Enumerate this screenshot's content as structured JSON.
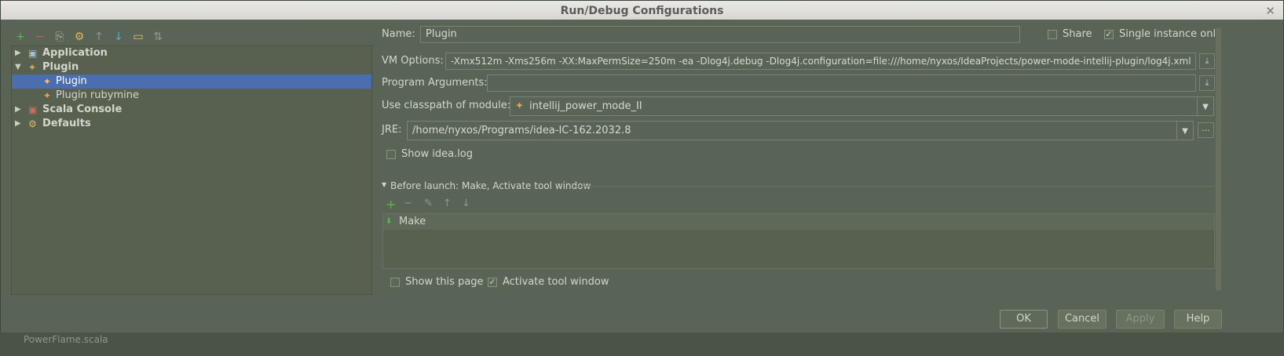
{
  "window": {
    "title": "Run/Debug Configurations",
    "close_glyph": "✕"
  },
  "left_toolbar": [
    {
      "name": "add-icon",
      "glyph": "+",
      "color": "#57b949"
    },
    {
      "name": "remove-icon",
      "glyph": "−",
      "color": "#d2604f"
    },
    {
      "name": "copy-icon",
      "glyph": "⎘",
      "color": "#aab3a6"
    },
    {
      "name": "settings-icon",
      "glyph": "⚙",
      "color": "#e2b45b"
    },
    {
      "name": "move-up-icon",
      "glyph": "↑",
      "color": "#8f988b"
    },
    {
      "name": "move-down-icon",
      "glyph": "↓",
      "color": "#5aa8d8"
    },
    {
      "name": "folder-icon",
      "glyph": "▭",
      "color": "#e2c15b"
    },
    {
      "name": "sort-icon",
      "glyph": "⇅",
      "color": "#8f988b"
    }
  ],
  "tree": {
    "items": [
      {
        "label": "Application",
        "expanded": false,
        "arrow": "▶",
        "icon": "▣"
      },
      {
        "label": "Plugin",
        "expanded": true,
        "arrow": "▼",
        "icon": "🔌"
      },
      {
        "label": "Plugin",
        "selected": true,
        "icon": "🔌"
      },
      {
        "label": "Plugin rubymine",
        "icon": "🔌"
      },
      {
        "label": "Scala Console",
        "expanded": false,
        "arrow": "▶",
        "icon": "▣"
      },
      {
        "label": "Defaults",
        "expanded": false,
        "arrow": "▶",
        "icon": "⚙"
      }
    ]
  },
  "form": {
    "name_label": "Name:",
    "name_value": "Plugin",
    "share_label": "Share",
    "share_checked": false,
    "single_instance_label": "Single instance only",
    "single_instance_checked": true,
    "vm_options_label": "VM Options:",
    "vm_options_value": "-Xmx512m -Xms256m -XX:MaxPermSize=250m -ea  -Dlog4j.debug -Dlog4j.configuration=file:///home/nyxos/IdeaProjects/power-mode-intellij-plugin/log4j.xml",
    "program_args_label": "Program Arguments:",
    "program_args_value": "",
    "classpath_label": "Use classpath of module:",
    "classpath_value": "intellij_power_mode_II",
    "jre_label": "JRE:",
    "jre_value": "/home/nyxos/Programs/idea-IC-162.2032.8",
    "show_idea_log_label": "Show idea.log",
    "show_idea_log_checked": false
  },
  "before_launch": {
    "header": "Before launch: Make, Activate tool window",
    "items": [
      "Make"
    ],
    "show_page_label": "Show this page",
    "show_page_checked": false,
    "activate_label": "Activate tool window",
    "activate_checked": true
  },
  "buttons": {
    "ok": "OK",
    "cancel": "Cancel",
    "apply": "Apply",
    "help": "Help"
  },
  "background": {
    "partial_text": "PowerFlame.scala"
  }
}
